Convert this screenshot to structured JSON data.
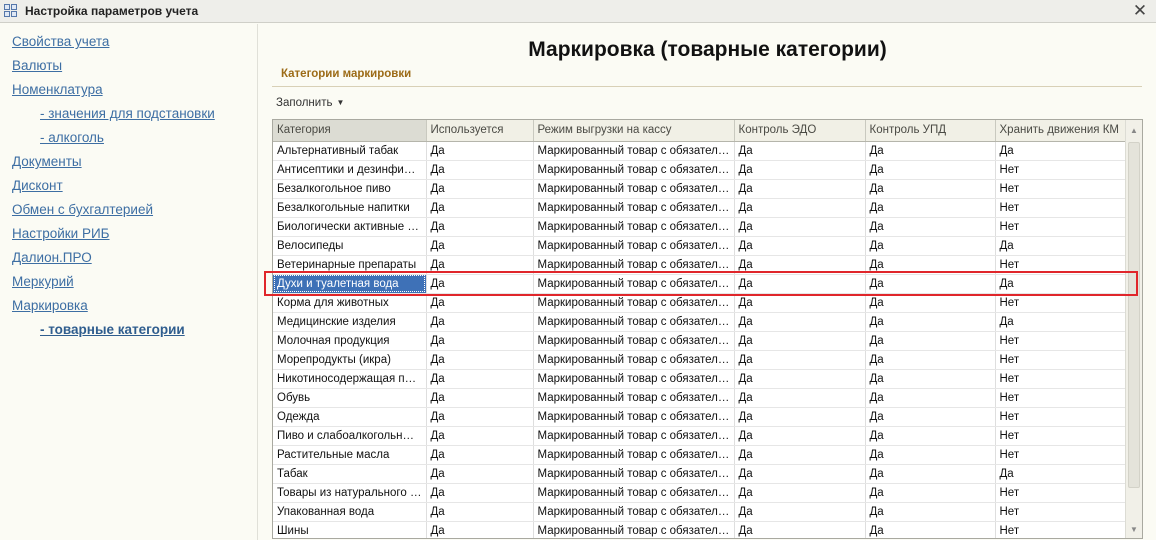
{
  "window": {
    "title": "Настройка параметров учета",
    "close_symbol": "✕"
  },
  "sidebar": {
    "items": [
      {
        "label": "Свойства учета",
        "level": 0
      },
      {
        "label": "Валюты",
        "level": 0
      },
      {
        "label": "Номенклатура",
        "level": 0
      },
      {
        "label": "- значения для подстановки",
        "level": 1
      },
      {
        "label": "- алкоголь",
        "level": 1
      },
      {
        "label": "Документы",
        "level": 0
      },
      {
        "label": "Дисконт",
        "level": 0
      },
      {
        "label": "Обмен с бухгалтерией",
        "level": 0
      },
      {
        "label": "Настройки РИБ",
        "level": 0
      },
      {
        "label": "Далион.ПРО",
        "level": 0
      },
      {
        "label": "Меркурий",
        "level": 0
      },
      {
        "label": "Маркировка",
        "level": 0
      },
      {
        "label": "- товарные категории",
        "level": 1,
        "active": true
      }
    ]
  },
  "main": {
    "title": "Маркировка (товарные категории)",
    "section_title": "Категории маркировки",
    "fill_button": "Заполнить"
  },
  "table": {
    "columns": [
      "Категория",
      "Используется",
      "Режим выгрузки на кассу",
      "Контроль ЭДО",
      "Контроль УПД",
      "Хранить движения КМ"
    ],
    "selected_row": 7,
    "rows": [
      [
        "Альтернативный табак",
        "Да",
        "Маркированный товар с обязательн...",
        "Да",
        "Да",
        "Да"
      ],
      [
        "Антисептики и дезинфици...",
        "Да",
        "Маркированный товар с обязательн...",
        "Да",
        "Да",
        "Нет"
      ],
      [
        "Безалкогольное пиво",
        "Да",
        "Маркированный товар с обязательн...",
        "Да",
        "Да",
        "Нет"
      ],
      [
        "Безалкогольные напитки",
        "Да",
        "Маркированный товар с обязательн...",
        "Да",
        "Да",
        "Нет"
      ],
      [
        "Биологически активные до...",
        "Да",
        "Маркированный товар с обязательн...",
        "Да",
        "Да",
        "Нет"
      ],
      [
        "Велосипеды",
        "Да",
        "Маркированный товар с обязательн...",
        "Да",
        "Да",
        "Да"
      ],
      [
        "Ветеринарные препараты",
        "Да",
        "Маркированный товар с обязательн...",
        "Да",
        "Да",
        "Нет"
      ],
      [
        "Духи и туалетная вода",
        "Да",
        "Маркированный товар с обязательн...",
        "Да",
        "Да",
        "Да"
      ],
      [
        "Корма для животных",
        "Да",
        "Маркированный товар с обязательн...",
        "Да",
        "Да",
        "Нет"
      ],
      [
        "Медицинские изделия",
        "Да",
        "Маркированный товар с обязательн...",
        "Да",
        "Да",
        "Да"
      ],
      [
        "Молочная продукция",
        "Да",
        "Маркированный товар с обязательн...",
        "Да",
        "Да",
        "Нет"
      ],
      [
        "Морепродукты (икра)",
        "Да",
        "Маркированный товар с обязательн...",
        "Да",
        "Да",
        "Нет"
      ],
      [
        "Никотиносодержащая про...",
        "Да",
        "Маркированный товар с обязательн...",
        "Да",
        "Да",
        "Нет"
      ],
      [
        "Обувь",
        "Да",
        "Маркированный товар с обязательн...",
        "Да",
        "Да",
        "Нет"
      ],
      [
        "Одежда",
        "Да",
        "Маркированный товар с обязательн...",
        "Да",
        "Да",
        "Нет"
      ],
      [
        "Пиво и слабоалкогольные ...",
        "Да",
        "Маркированный товар с обязательн...",
        "Да",
        "Да",
        "Нет"
      ],
      [
        "Растительные масла",
        "Да",
        "Маркированный товар с обязательн...",
        "Да",
        "Да",
        "Нет"
      ],
      [
        "Табак",
        "Да",
        "Маркированный товар с обязательн...",
        "Да",
        "Да",
        "Да"
      ],
      [
        "Товары из натурального м...",
        "Да",
        "Маркированный товар с обязательн...",
        "Да",
        "Да",
        "Нет"
      ],
      [
        "Упакованная вода",
        "Да",
        "Маркированный товар с обязательн...",
        "Да",
        "Да",
        "Нет"
      ],
      [
        "Шины",
        "Да",
        "Маркированный товар с обязательн...",
        "Да",
        "Да",
        "Нет"
      ]
    ]
  },
  "colors": {
    "link": "#3d6ea3",
    "section_title": "#9c6b17",
    "selection": "#3e71b7",
    "highlight_frame": "#e0262b"
  }
}
